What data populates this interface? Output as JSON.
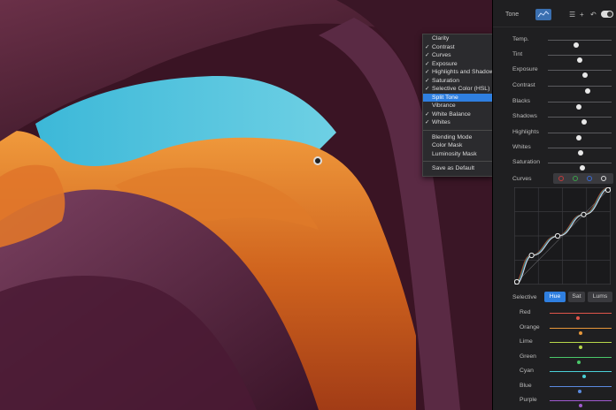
{
  "panel": {
    "title": "Tone"
  },
  "menu": {
    "items": [
      {
        "label": "Clarity",
        "checked": false
      },
      {
        "label": "Contrast",
        "checked": true
      },
      {
        "label": "Curves",
        "checked": true
      },
      {
        "label": "Exposure",
        "checked": true
      },
      {
        "label": "Highlights and Shadows",
        "checked": true
      },
      {
        "label": "Saturation",
        "checked": true
      },
      {
        "label": "Selective Color (HSL)",
        "checked": true
      },
      {
        "label": "Split Tone",
        "checked": false,
        "active": true
      },
      {
        "label": "Vibrance",
        "checked": false
      },
      {
        "label": "White Balance",
        "checked": true
      },
      {
        "label": "Whites",
        "checked": true
      }
    ],
    "items2": [
      {
        "label": "Blending Mode"
      },
      {
        "label": "Color Mask"
      },
      {
        "label": "Luminosity Mask"
      }
    ],
    "items3": [
      {
        "label": "Save as Default"
      }
    ]
  },
  "sliders": [
    {
      "label": "Temp.",
      "value": 0.45
    },
    {
      "label": "Tint",
      "value": 0.5
    },
    {
      "label": "Exposure",
      "value": 0.58
    },
    {
      "label": "Contrast",
      "value": 0.62
    },
    {
      "label": "Blacks",
      "value": 0.48
    },
    {
      "label": "Shadows",
      "value": 0.57
    },
    {
      "label": "Highlights",
      "value": 0.48
    },
    {
      "label": "Whites",
      "value": 0.52
    },
    {
      "label": "Saturation",
      "value": 0.54
    }
  ],
  "curves": {
    "label": "Curves",
    "channel_colors": [
      "#c03a3a",
      "#3aa04a",
      "#3a6ad0",
      "#dddddd"
    ],
    "points": [
      [
        0,
        0
      ],
      [
        0.18,
        0.3
      ],
      [
        0.45,
        0.5
      ],
      [
        0.72,
        0.72
      ],
      [
        1,
        1
      ]
    ]
  },
  "selective": {
    "label": "Selective",
    "tabs": {
      "hue": "Hue",
      "sat": "Sat",
      "lums": "Lums"
    },
    "colors": [
      {
        "label": "Red",
        "value": 0.45,
        "color": "#e0554a"
      },
      {
        "label": "Orange",
        "value": 0.5,
        "color": "#e8973a"
      },
      {
        "label": "Lime",
        "value": 0.5,
        "color": "#b8d84a"
      },
      {
        "label": "Green",
        "value": 0.47,
        "color": "#4ac86a"
      },
      {
        "label": "Cyan",
        "value": 0.55,
        "color": "#4ad0d8"
      },
      {
        "label": "Blue",
        "value": 0.48,
        "color": "#5a8ae0"
      },
      {
        "label": "Purple",
        "value": 0.5,
        "color": "#a05ad0"
      }
    ]
  }
}
